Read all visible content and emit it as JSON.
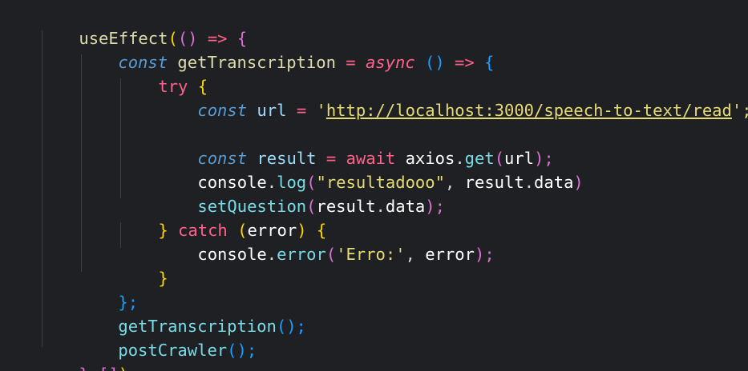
{
  "code": {
    "l1": {
      "a": "useEffect",
      "b": "(",
      "c": "() ",
      "d": "=>",
      "e": " {"
    },
    "l2": {
      "a": "const",
      "b": " getTranscription ",
      "c": "=",
      "d": " async",
      "e": " () ",
      "f": "=>",
      "g": " {"
    },
    "l3": {
      "a": "try",
      "b": " {"
    },
    "l4": {
      "a": "const",
      "b": " url ",
      "c": "=",
      "d": " '",
      "e": "http://localhost:3000/speech-to-text/read",
      "f": "';"
    },
    "l6": {
      "a": "const",
      "b": " result ",
      "c": "=",
      "d": " await",
      "e": " axios",
      "f": ".",
      "g": "get",
      "h": "(",
      "i": "url",
      "j": ");"
    },
    "l7": {
      "a": "console",
      "b": ".",
      "c": "log",
      "d": "(",
      "e": "\"resultadooo\"",
      "f": ", ",
      "g": "result",
      "h": ".",
      "i": "data",
      "j": ")"
    },
    "l8": {
      "a": "setQuestion",
      "b": "(",
      "c": "result",
      "d": ".",
      "e": "data",
      "f": ");"
    },
    "l9": {
      "a": "}",
      "b": " catch",
      "c": " (",
      "d": "error",
      "e": ")",
      "f": " {"
    },
    "l10": {
      "a": "console",
      "b": ".",
      "c": "error",
      "d": "(",
      "e": "'Erro:'",
      "f": ", ",
      "g": "error",
      "h": ");"
    },
    "l11": {
      "a": "}"
    },
    "l12": {
      "a": "};"
    },
    "l13": {
      "a": "getTranscription",
      "b": "();"
    },
    "l14": {
      "a": "postCrawler",
      "b": "();"
    },
    "l15": {
      "a": "}",
      "b": ",",
      "c": "[",
      "d": "]",
      "e": ");"
    }
  },
  "colors": {
    "background": "#1f2023",
    "function": "#dcdcaa",
    "keyword": "#569cd6",
    "control": "#ff6188",
    "string": "#e6db74",
    "property": "#78dce8",
    "text": "#d4d4d4"
  }
}
